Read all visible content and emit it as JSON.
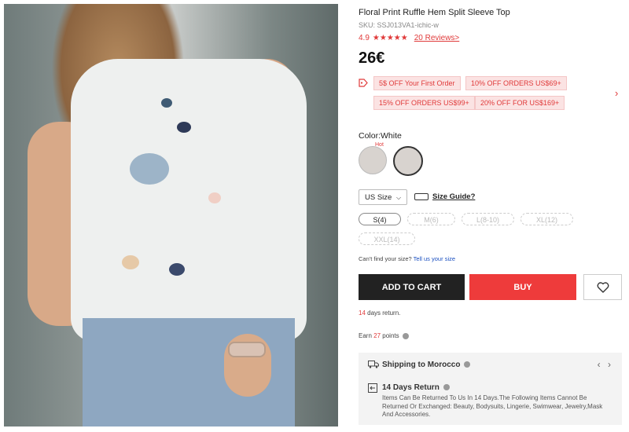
{
  "product": {
    "title": "Floral Print Ruffle Hem Split Sleeve Top",
    "sku": "SKU: SSJ013VA1-ichic-w",
    "rating_value": "4.9",
    "rating_stars": "★★★★★",
    "reviews_link": "20 Reviews>",
    "price": "26€"
  },
  "coupons": [
    "5$ OFF Your First Order",
    "10% OFF ORDERS US$69+",
    "15% OFF ORDERS US$99+",
    "20% OFF FOR US$169+"
  ],
  "color": {
    "label": "Color:White",
    "hot_badge": "Hot"
  },
  "size": {
    "selector_label": "US Size",
    "guide_label": "Size Guide?",
    "options": [
      {
        "label": "S(4)",
        "available": true
      },
      {
        "label": "M(6)",
        "available": false
      },
      {
        "label": "L(8-10)",
        "available": false
      },
      {
        "label": "XL(12)",
        "available": false
      },
      {
        "label": "XXL(14)",
        "available": false
      }
    ],
    "cant_find_text": "Can't find your size?",
    "cant_find_link": "Tell us your size"
  },
  "actions": {
    "add_to_cart": "ADD TO CART",
    "buy": "BUY"
  },
  "returns": {
    "days": "14",
    "suffix": "days return."
  },
  "earn": {
    "prefix": "Earn",
    "points": "27",
    "suffix": "points"
  },
  "shipping": {
    "title": "Shipping to Morocco",
    "return_title": "14 Days Return",
    "return_desc": "Items Can Be Returned To Us In 14 Days.The Following Items Cannot Be Returned Or Exchanged: Beauty, Bodysuits, Lingerie, Swimwear, Jewelry,Mask And Accessories."
  },
  "colors": {
    "accent_red": "#ee3b3b",
    "coupon_bg": "#fbe3e3",
    "dark_button": "#222222"
  }
}
